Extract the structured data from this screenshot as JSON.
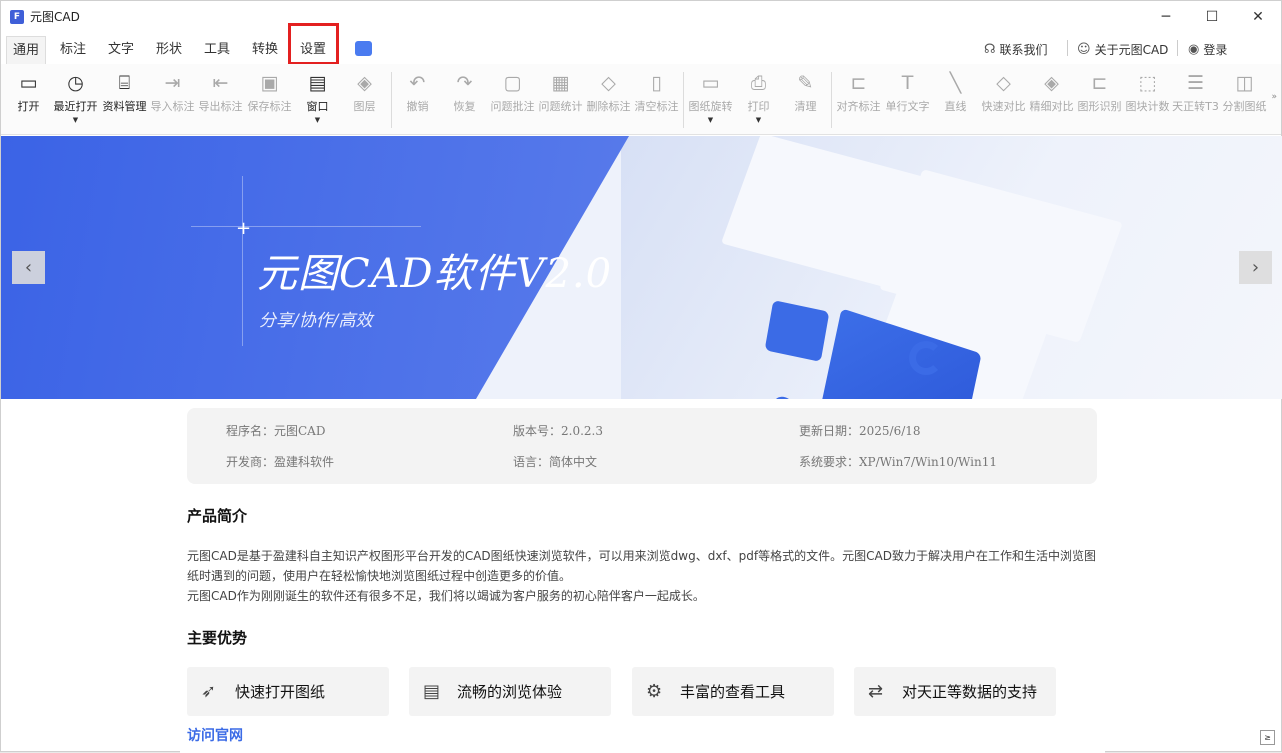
{
  "window": {
    "title": "元图CAD",
    "logo_letter": "F"
  },
  "win_controls": {
    "minimize": "─",
    "maximize": "☐",
    "close": "✕"
  },
  "menu": {
    "tabs": [
      "通用",
      "标注",
      "文字",
      "形状",
      "工具",
      "转换",
      "设置"
    ],
    "active_tab": "通用",
    "highlighted_tab": "设置"
  },
  "topright": {
    "contact": "联系我们",
    "about": "关于元图CAD",
    "login": "登录"
  },
  "toolbar": {
    "items": [
      {
        "label": "打开",
        "icon": "▭"
      },
      {
        "label": "最近打开",
        "icon": "◷",
        "arrow": "▼"
      },
      {
        "label": "资料管理",
        "icon": "⌸"
      },
      {
        "label": "导入标注",
        "icon": "⇥"
      },
      {
        "label": "导出标注",
        "icon": "⇤"
      },
      {
        "label": "保存标注",
        "icon": "▣"
      },
      {
        "label": "窗口",
        "icon": "▤",
        "arrow": "▼"
      },
      {
        "label": "图层",
        "icon": "◈"
      },
      {
        "label": "撤销",
        "icon": "↶"
      },
      {
        "label": "恢复",
        "icon": "↷"
      },
      {
        "label": "问题批注",
        "icon": "▢"
      },
      {
        "label": "问题统计",
        "icon": "▦"
      },
      {
        "label": "删除标注",
        "icon": "◇"
      },
      {
        "label": "清空标注",
        "icon": "▯"
      },
      {
        "label": "图纸旋转",
        "icon": "▭",
        "arrow": "▼"
      },
      {
        "label": "打印",
        "icon": "⎙",
        "arrow": "▼"
      },
      {
        "label": "清理",
        "icon": "✎"
      },
      {
        "label": "对齐标注",
        "icon": "⊏"
      },
      {
        "label": "单行文字",
        "icon": "T"
      },
      {
        "label": "直线",
        "icon": "╲"
      },
      {
        "label": "快速对比",
        "icon": "◇"
      },
      {
        "label": "精细对比",
        "icon": "◈"
      },
      {
        "label": "图形识别",
        "icon": "⊏"
      },
      {
        "label": "图块计数",
        "icon": "⬚"
      },
      {
        "label": "天正转T3",
        "icon": "☰"
      },
      {
        "label": "分割图纸",
        "icon": "◫"
      }
    ],
    "more": "»"
  },
  "banner": {
    "title": "元图CAD软件V2.0",
    "subtitle": "分享/协作/高效",
    "cad_text": "CAD",
    "prev": "‹",
    "next": "›"
  },
  "info": {
    "program": "程序名：元图CAD",
    "version": "版本号：2.0.2.3",
    "update_date": "更新日期：2025/6/18",
    "developer": "开发商：盈建科软件",
    "language": "语言：简体中文",
    "system": "系统要求：XP/Win7/Win10/Win11"
  },
  "intro": {
    "heading": "产品简介",
    "para1": "元图CAD是基于盈建科自主知识产权图形平台开发的CAD图纸快速浏览软件，可以用来浏览dwg、dxf、pdf等格式的文件。元图CAD致力于解决用户在工作和生活中浏览图纸时遇到的问题，使用户在轻松愉快地浏览图纸过程中创造更多的价值。",
    "para2": "元图CAD作为刚刚诞生的软件还有很多不足，我们将以竭诚为客户服务的初心陪伴客户一起成长。"
  },
  "advantages": {
    "heading": "主要优势",
    "items": [
      {
        "label": "快速打开图纸",
        "icon": "rocket-icon"
      },
      {
        "label": "流畅的浏览体验",
        "icon": "document-icon"
      },
      {
        "label": "丰富的查看工具",
        "icon": "tools-icon"
      },
      {
        "label": "对天正等数据的支持",
        "icon": "data-support-icon"
      }
    ],
    "visit_link": "访问官网"
  },
  "corner_button": "≥"
}
